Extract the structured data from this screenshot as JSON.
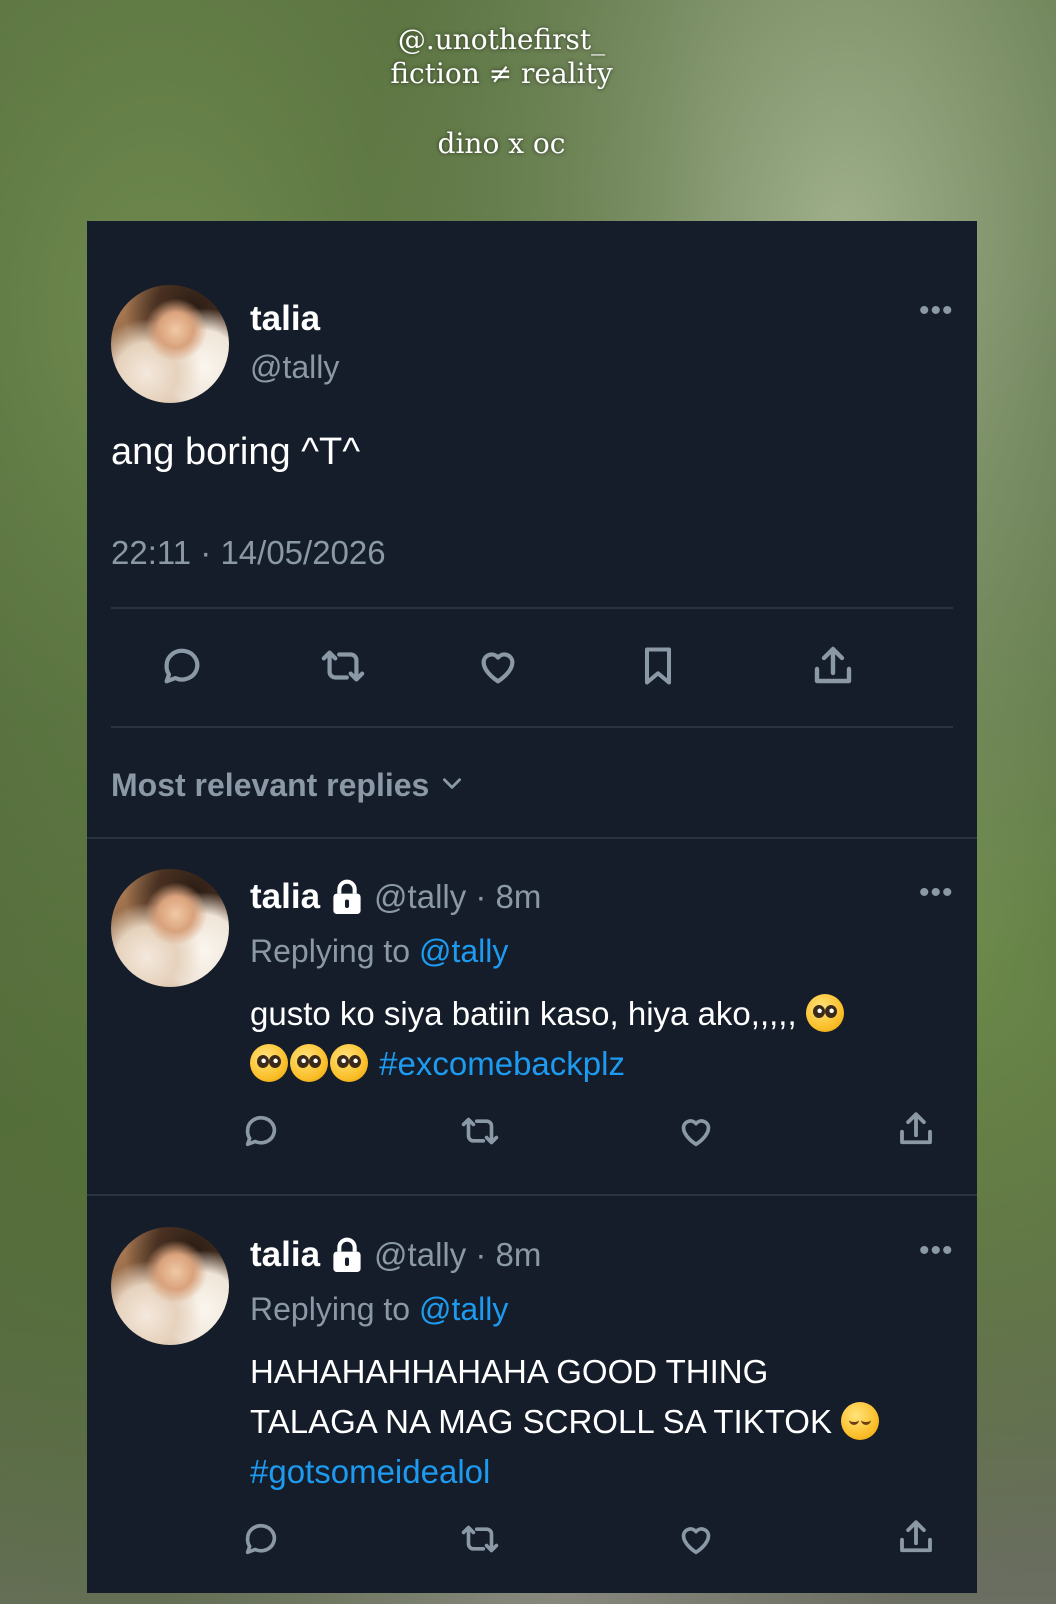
{
  "overlay": {
    "line1": "@.unothefirst_",
    "line2": "fiction ≠ reality",
    "line3": "dino x oc"
  },
  "main_tweet": {
    "name": "talia",
    "handle": "@tally",
    "text": "ang boring ^T^",
    "timestamp": "22:11 · 14/05/2026",
    "actions": [
      "reply-icon",
      "retweet-icon",
      "like-icon",
      "bookmark-icon",
      "share-icon"
    ]
  },
  "replies_sort": {
    "label": "Most relevant replies"
  },
  "replies": [
    {
      "name": "talia",
      "handle_time": "@tally · 8m",
      "replying_prefix": "Replying to",
      "replying_to": "@tally",
      "text_part1": "gusto ko siya batiin kaso, hiya ako,,,,,",
      "hashtag": "#excomebackplz"
    },
    {
      "name": "talia",
      "handle_time": "@tally · 8m",
      "replying_prefix": "Replying to",
      "replying_to": "@tally",
      "text_line1": "HAHAHAHHAHAHA GOOD THING",
      "text_line2": "TALAGA NA MAG SCROLL SA TIKTOK",
      "hashtag": "#gotsomeidealol"
    }
  ],
  "colors": {
    "card_bg": "#151d2a",
    "muted": "#8b98a5",
    "link": "#1d9bf0"
  }
}
